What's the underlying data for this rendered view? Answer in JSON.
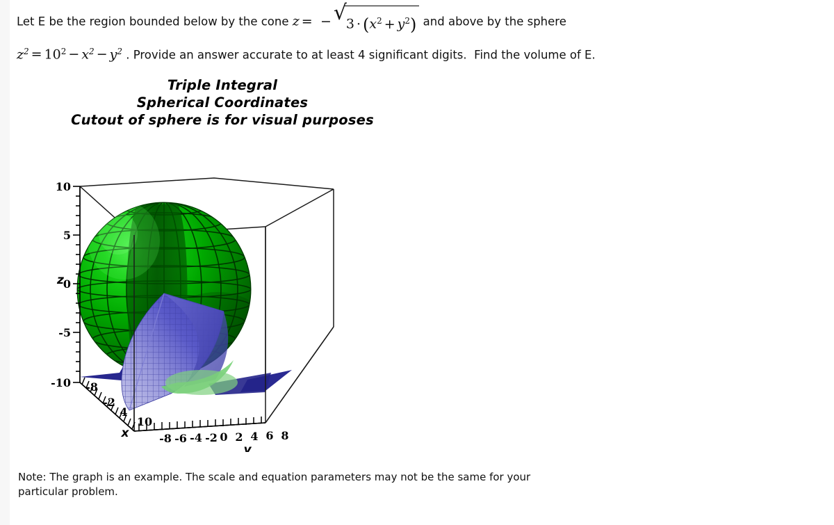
{
  "problem": {
    "line1_pre": "Let E be the region bounded below by the cone",
    "line1_var_z": "z",
    "line1_eq": "=",
    "line1_minus": "−",
    "line1_radicand_a": "3",
    "line1_cdot": "·",
    "line1_radicand_x": "x",
    "line1_plus": "+",
    "line1_radicand_y": "y",
    "line1_post": "and above by the sphere",
    "line2_z": "z",
    "line2_eq": "=",
    "line2_ten": "10",
    "line2_minus1": "−",
    "line2_x": "x",
    "line2_minus2": "−",
    "line2_y": "y",
    "line2_post": ". Provide an answer accurate to at least 4 significant digits.",
    "line2_post2": "Find the volume of E.",
    "exp_two": "2"
  },
  "title": {
    "line1": "Triple Integral",
    "line2": "Spherical Coordinates",
    "line3": "Cutout of sphere is for visual purposes"
  },
  "footer": {
    "line1": "Note:  The graph is an example.  The scale and equation parameters may not be the same for your",
    "line2": "particular problem."
  },
  "chart_data": {
    "type": "surface3d",
    "title": "Triple Integral Spherical Coordinates",
    "description": "3D plot of a green sphere of radius 10 centered at the origin with a blue cone z = -sqrt(3(x^2+y^2)) opening downward, drawn inside a wireframe bounding box. A wedge cutout is removed from the sphere to reveal the interior cone.",
    "xlabel": "x",
    "ylabel": "y",
    "zlabel": "z",
    "xticks": [
      "-8",
      "-2",
      "4",
      "10"
    ],
    "yticks": [
      "-8",
      "-6",
      "-4",
      "-2",
      "0",
      "2",
      "4",
      "6",
      "8"
    ],
    "zticks": [
      "10",
      "5",
      "0",
      "-5",
      "-10"
    ],
    "xlim": [
      -10,
      10
    ],
    "ylim": [
      -10,
      10
    ],
    "zlim": [
      -10,
      10
    ],
    "grid": false,
    "legend": "none",
    "surfaces": [
      {
        "name": "sphere",
        "equation": "z^2 = 10^2 - x^2 - y^2",
        "radius": 10,
        "color": "#00a000",
        "highlight_color": "#2ee02e",
        "shadow_color": "#006a00",
        "mesh_color": "#003300"
      },
      {
        "name": "cone",
        "equation": "z = -sqrt(3*(x^2+y^2))",
        "color": "#5a5ac8",
        "highlight_color": "#b9b9e4",
        "shadow_color": "#26268c",
        "mesh_color": "#3a3a9e"
      }
    ],
    "box_color": "#1a1a1a"
  },
  "colors": {
    "sphere_green": "#00a000",
    "cone_blue": "#5a5ac8",
    "cone_navy": "#26268c",
    "axis_black": "#000000",
    "page_background": "#ffffff"
  }
}
